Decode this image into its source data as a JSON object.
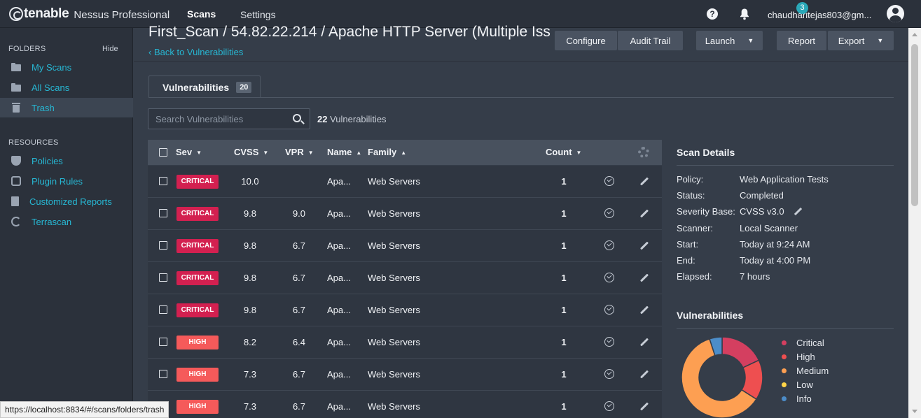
{
  "topbar": {
    "brand": "tenable",
    "product": "Nessus Professional",
    "nav": {
      "scans": "Scans",
      "settings": "Settings"
    },
    "help_glyph": "?",
    "notification_count": "3",
    "user": "chaudharitejas803@gm..."
  },
  "sidebar": {
    "folders_heading": "FOLDERS",
    "hide_label": "Hide",
    "folders": [
      {
        "label": "My Scans",
        "icon": "folder-icon"
      },
      {
        "label": "All Scans",
        "icon": "folder-icon"
      },
      {
        "label": "Trash",
        "icon": "trash-icon"
      }
    ],
    "resources_heading": "RESOURCES",
    "resources": [
      {
        "label": "Policies",
        "icon": "shield-icon"
      },
      {
        "label": "Plugin Rules",
        "icon": "plugin-icon"
      },
      {
        "label": "Customized Reports",
        "icon": "report-icon"
      },
      {
        "label": "Terrascan",
        "icon": "radar-icon"
      }
    ]
  },
  "header": {
    "title": "First_Scan / 54.82.22.214 / Apache HTTP Server (Multiple Iss",
    "back_link": "‹ Back to Vulnerabilities",
    "buttons": {
      "configure": "Configure",
      "audit_trail": "Audit Trail",
      "launch": "Launch",
      "report": "Report",
      "export": "Export",
      "caret": "▼"
    }
  },
  "tabs": {
    "vulnerabilities_label": "Vulnerabilities",
    "vulnerabilities_count": "20"
  },
  "search": {
    "placeholder": "Search Vulnerabilities",
    "total_count": "22",
    "total_label": "Vulnerabilities"
  },
  "table": {
    "headers": {
      "sev": "Sev",
      "cvss": "CVSS",
      "vpr": "VPR",
      "name": "Name",
      "family": "Family",
      "count": "Count",
      "sort_down": "▼",
      "sort_up": "▲"
    },
    "rows": [
      {
        "sev": "CRITICAL",
        "cvss": "10.0",
        "vpr": "",
        "name": "Apa...",
        "family": "Web Servers",
        "count": "1"
      },
      {
        "sev": "CRITICAL",
        "cvss": "9.8",
        "vpr": "9.0",
        "name": "Apa...",
        "family": "Web Servers",
        "count": "1"
      },
      {
        "sev": "CRITICAL",
        "cvss": "9.8",
        "vpr": "6.7",
        "name": "Apa...",
        "family": "Web Servers",
        "count": "1"
      },
      {
        "sev": "CRITICAL",
        "cvss": "9.8",
        "vpr": "6.7",
        "name": "Apa...",
        "family": "Web Servers",
        "count": "1"
      },
      {
        "sev": "CRITICAL",
        "cvss": "9.8",
        "vpr": "6.7",
        "name": "Apa...",
        "family": "Web Servers",
        "count": "1"
      },
      {
        "sev": "HIGH",
        "cvss": "8.2",
        "vpr": "6.4",
        "name": "Apa...",
        "family": "Web Servers",
        "count": "1"
      },
      {
        "sev": "HIGH",
        "cvss": "7.3",
        "vpr": "6.7",
        "name": "Apa...",
        "family": "Web Servers",
        "count": "1"
      },
      {
        "sev": "HIGH",
        "cvss": "7.3",
        "vpr": "6.7",
        "name": "Apa...",
        "family": "Web Servers",
        "count": "1"
      }
    ]
  },
  "scan_details": {
    "title": "Scan Details",
    "fields": [
      {
        "label": "Policy:",
        "value": "Web Application Tests"
      },
      {
        "label": "Status:",
        "value": "Completed"
      },
      {
        "label": "Severity Base:",
        "value": "CVSS v3.0"
      },
      {
        "label": "Scanner:",
        "value": "Local Scanner"
      },
      {
        "label": "Start:",
        "value": "Today at 9:24 AM"
      },
      {
        "label": "End:",
        "value": "Today at 4:00 PM"
      },
      {
        "label": "Elapsed:",
        "value": "7 hours"
      }
    ]
  },
  "vuln_chart": {
    "title": "Vulnerabilities",
    "legend": [
      {
        "label": "Critical",
        "color": "#d43f60"
      },
      {
        "label": "High",
        "color": "#ee4f50"
      },
      {
        "label": "Medium",
        "color": "#fd9f52"
      },
      {
        "label": "Low",
        "color": "#ffd548"
      },
      {
        "label": "Info",
        "color": "#4c8dc9"
      }
    ],
    "shares": {
      "Critical": 0.18,
      "High": 0.16,
      "Medium": 0.61,
      "Low": 0,
      "Info": 0.05
    }
  },
  "colors": {
    "critical_badge": "#d32050",
    "high_badge": "#f55a5a",
    "accent_link": "#27b7d3",
    "notification": "#2aa8b8"
  },
  "status_url": "https://localhost:8834/#/scans/folders/trash"
}
